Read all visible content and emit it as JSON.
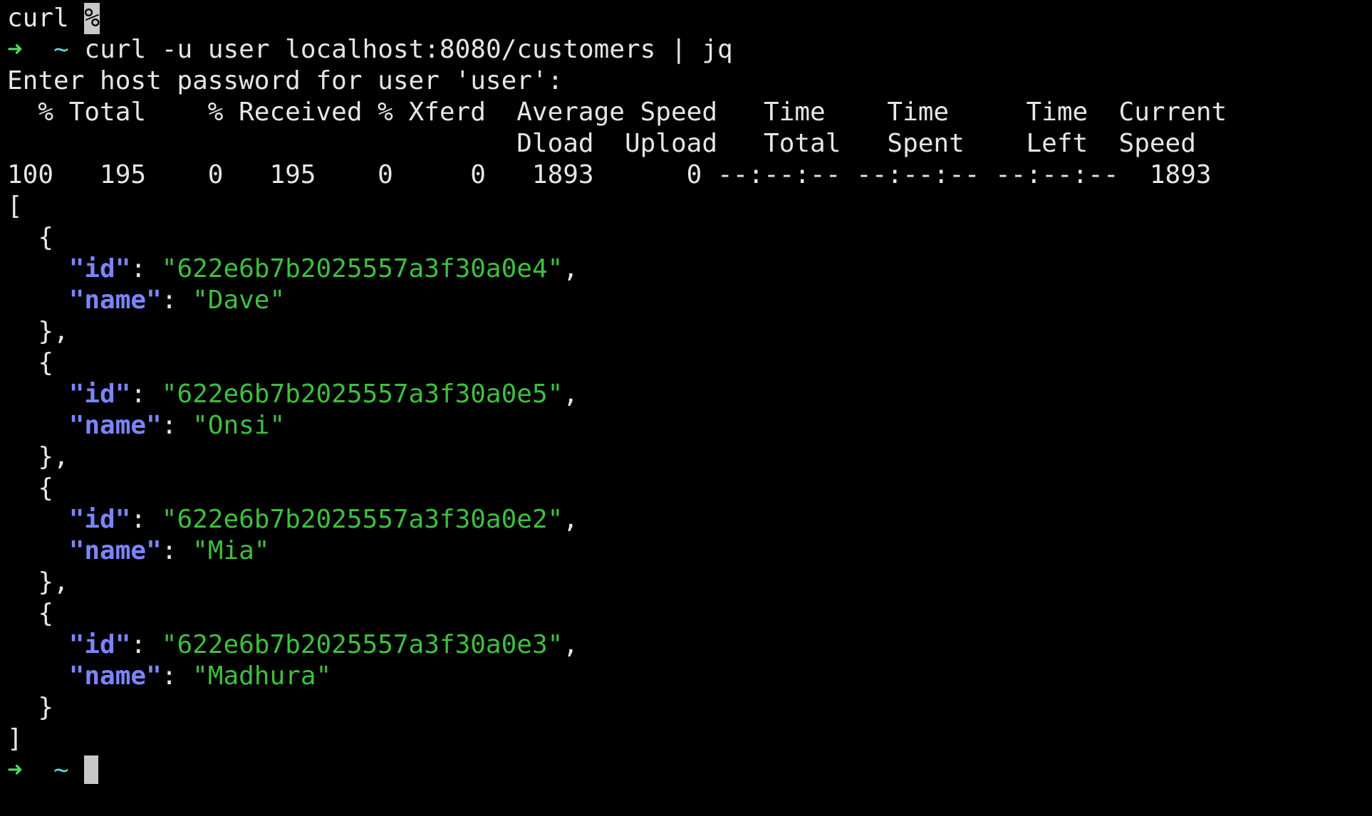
{
  "colors": {
    "background": "#000000",
    "text": "#e6e6e6",
    "prompt_arrow": "#4fd36a",
    "prompt_tilde": "#5ad8d8",
    "json_key": "#7b85ff",
    "json_string": "#3fbf3f",
    "cursor": "#c8c8c8"
  },
  "icons": {
    "prompt_arrow": "arrow-icon"
  },
  "terminal": {
    "prev_cmd": "curl",
    "prev_prompt_symbol": "%",
    "prompt_arrow": "➜",
    "prompt_dir": "~",
    "command": "curl -u user localhost:8080/customers | jq",
    "password_prompt": "Enter host password for user 'user':",
    "progress_header_1": "  % Total    % Received % Xferd  Average Speed   Time    Time     Time  Current",
    "progress_header_2": "                                 Dload  Upload   Total   Spent    Left  Speed",
    "progress_values": "100   195    0   195    0     0   1893      0 --:--:-- --:--:-- --:--:--  1893",
    "open_bracket": "[",
    "close_bracket": "]",
    "open_brace": "  {",
    "close_brace_comma": "  },",
    "close_brace": "  }",
    "indent": "    ",
    "colon": ": ",
    "comma": ",",
    "id_key": "\"id\"",
    "name_key": "\"name\"",
    "customers": [
      {
        "id": "\"622e6b7b2025557a3f30a0e4\"",
        "name": "\"Dave\""
      },
      {
        "id": "\"622e6b7b2025557a3f30a0e5\"",
        "name": "\"Onsi\""
      },
      {
        "id": "\"622e6b7b2025557a3f30a0e2\"",
        "name": "\"Mia\""
      },
      {
        "id": "\"622e6b7b2025557a3f30a0e3\"",
        "name": "\"Madhura\""
      }
    ]
  }
}
